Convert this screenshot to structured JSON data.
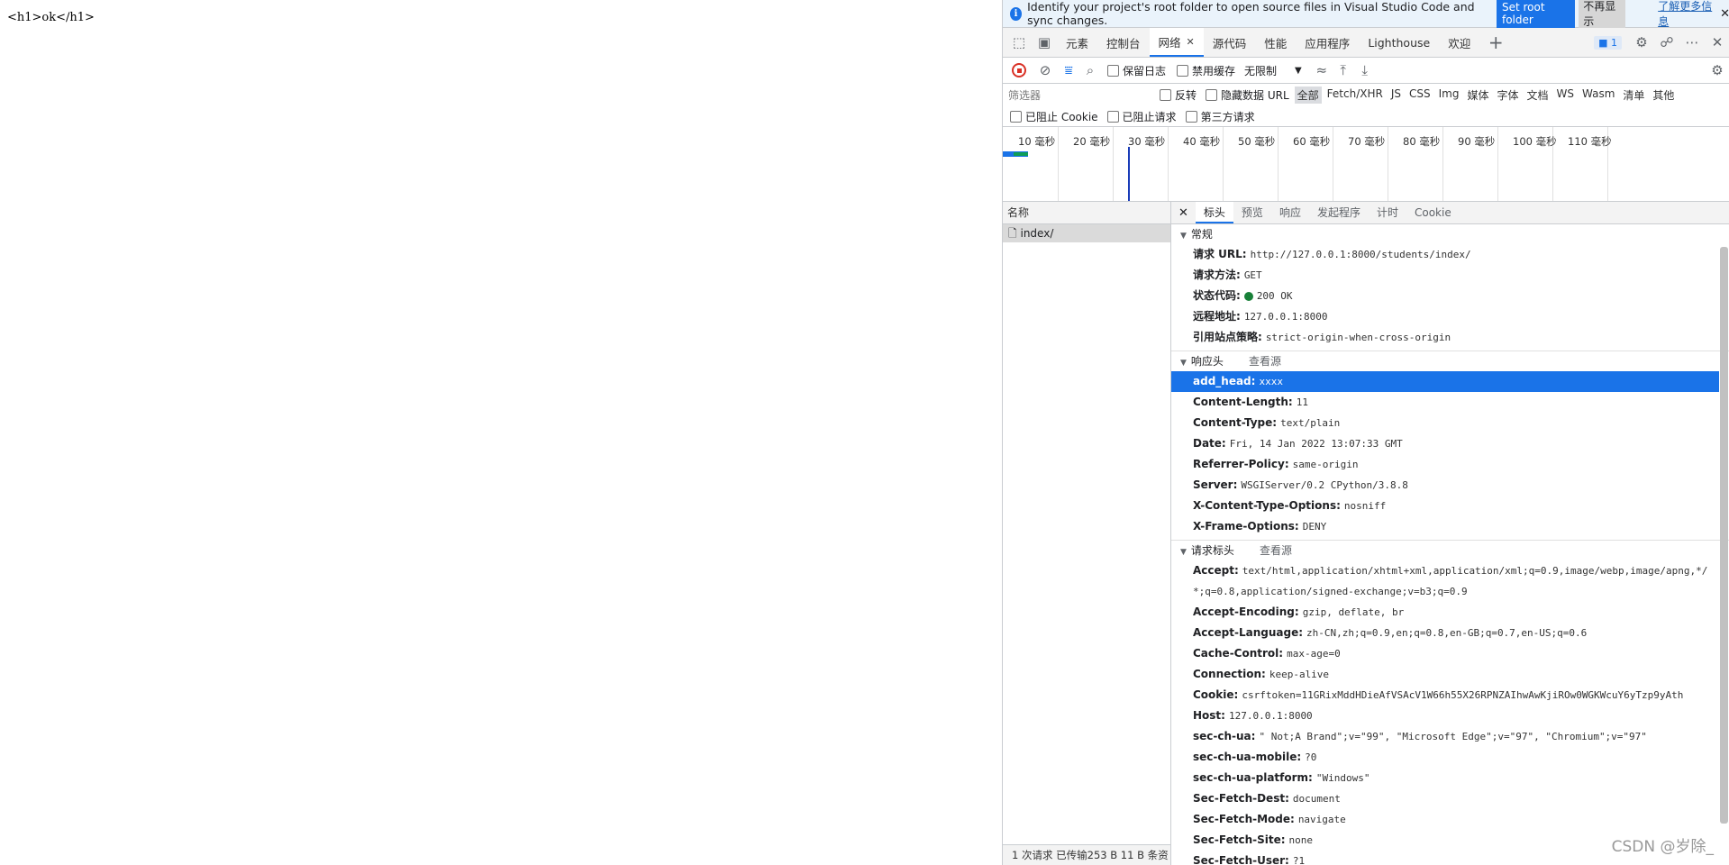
{
  "page": {
    "content": "<h1>ok</h1>"
  },
  "infobar": {
    "text": "Identify your project's root folder to open source files in Visual Studio Code and sync changes.",
    "primary_button": "Set root folder",
    "secondary_button": "不再显示",
    "link": "了解更多信息"
  },
  "tabs": [
    {
      "label": "元素",
      "active": false
    },
    {
      "label": "控制台",
      "active": false
    },
    {
      "label": "网络",
      "active": true
    },
    {
      "label": "源代码",
      "active": false
    },
    {
      "label": "性能",
      "active": false
    },
    {
      "label": "应用程序",
      "active": false
    },
    {
      "label": "Lighthouse",
      "active": false
    },
    {
      "label": "欢迎",
      "active": false
    }
  ],
  "issues_count": "1",
  "network_toolbar": {
    "preserve_log": "保留日志",
    "disable_cache": "禁用缓存",
    "throttle": "无限制"
  },
  "filter": {
    "placeholder": "筛选器",
    "invert": "反转",
    "hide_data_urls": "隐藏数据 URL",
    "types": [
      "全部",
      "Fetch/XHR",
      "JS",
      "CSS",
      "Img",
      "媒体",
      "字体",
      "文档",
      "WS",
      "Wasm",
      "清单",
      "其他"
    ],
    "active_type": "全部",
    "blocked_cookies": "已阻止 Cookie",
    "blocked_requests": "已阻止请求",
    "third_party": "第三方请求"
  },
  "timeline": {
    "ticks": [
      "10 毫秒",
      "20 毫秒",
      "30 毫秒",
      "40 毫秒",
      "50 毫秒",
      "60 毫秒",
      "70 毫秒",
      "80 毫秒",
      "90 毫秒",
      "100 毫秒",
      "110 毫秒"
    ]
  },
  "requests": {
    "header": "名称",
    "items": [
      "index/"
    ]
  },
  "status": "1 次请求   已传输253 B   11 B 条资",
  "detail_tabs": [
    {
      "label": "标头",
      "active": true
    },
    {
      "label": "预览",
      "active": false
    },
    {
      "label": "响应",
      "active": false
    },
    {
      "label": "发起程序",
      "active": false
    },
    {
      "label": "计时",
      "active": false
    },
    {
      "label": "Cookie",
      "active": false
    }
  ],
  "general": {
    "title": "常规",
    "rows": [
      {
        "k": "请求 URL:",
        "v": "http://127.0.0.1:8000/students/index/"
      },
      {
        "k": "请求方法:",
        "v": "GET"
      },
      {
        "k": "状态代码:",
        "v": "200 OK",
        "status_ok": true
      },
      {
        "k": "远程地址:",
        "v": "127.0.0.1:8000"
      },
      {
        "k": "引用站点策略:",
        "v": "strict-origin-when-cross-origin"
      }
    ]
  },
  "response_headers": {
    "title": "响应头",
    "view_source": "查看源",
    "rows": [
      {
        "k": "add_head:",
        "v": "xxxx",
        "selected": true
      },
      {
        "k": "Content-Length:",
        "v": "11"
      },
      {
        "k": "Content-Type:",
        "v": "text/plain"
      },
      {
        "k": "Date:",
        "v": "Fri, 14 Jan 2022 13:07:33 GMT"
      },
      {
        "k": "Referrer-Policy:",
        "v": "same-origin"
      },
      {
        "k": "Server:",
        "v": "WSGIServer/0.2 CPython/3.8.8"
      },
      {
        "k": "X-Content-Type-Options:",
        "v": "nosniff"
      },
      {
        "k": "X-Frame-Options:",
        "v": "DENY"
      }
    ]
  },
  "request_headers": {
    "title": "请求标头",
    "view_source": "查看源",
    "rows": [
      {
        "k": "Accept:",
        "v": "text/html,application/xhtml+xml,application/xml;q=0.9,image/webp,image/apng,*/*;q=0.8,application/signed-exchange;v=b3;q=0.9",
        "wrap": true
      },
      {
        "k": "Accept-Encoding:",
        "v": "gzip, deflate, br"
      },
      {
        "k": "Accept-Language:",
        "v": "zh-CN,zh;q=0.9,en;q=0.8,en-GB;q=0.7,en-US;q=0.6"
      },
      {
        "k": "Cache-Control:",
        "v": "max-age=0"
      },
      {
        "k": "Connection:",
        "v": "keep-alive"
      },
      {
        "k": "Cookie:",
        "v": "csrftoken=11GRixMddHDieAfVSAcV1W66h55X26RPNZAIhwAwKjiROw0WGKWcuY6yTzp9yAth"
      },
      {
        "k": "Host:",
        "v": "127.0.0.1:8000"
      },
      {
        "k": "sec-ch-ua:",
        "v": "\" Not;A Brand\";v=\"99\", \"Microsoft Edge\";v=\"97\", \"Chromium\";v=\"97\""
      },
      {
        "k": "sec-ch-ua-mobile:",
        "v": "?0"
      },
      {
        "k": "sec-ch-ua-platform:",
        "v": "\"Windows\""
      },
      {
        "k": "Sec-Fetch-Dest:",
        "v": "document"
      },
      {
        "k": "Sec-Fetch-Mode:",
        "v": "navigate"
      },
      {
        "k": "Sec-Fetch-Site:",
        "v": "none"
      },
      {
        "k": "Sec-Fetch-User:",
        "v": "?1"
      }
    ]
  },
  "watermark": "CSDN @岁除_"
}
